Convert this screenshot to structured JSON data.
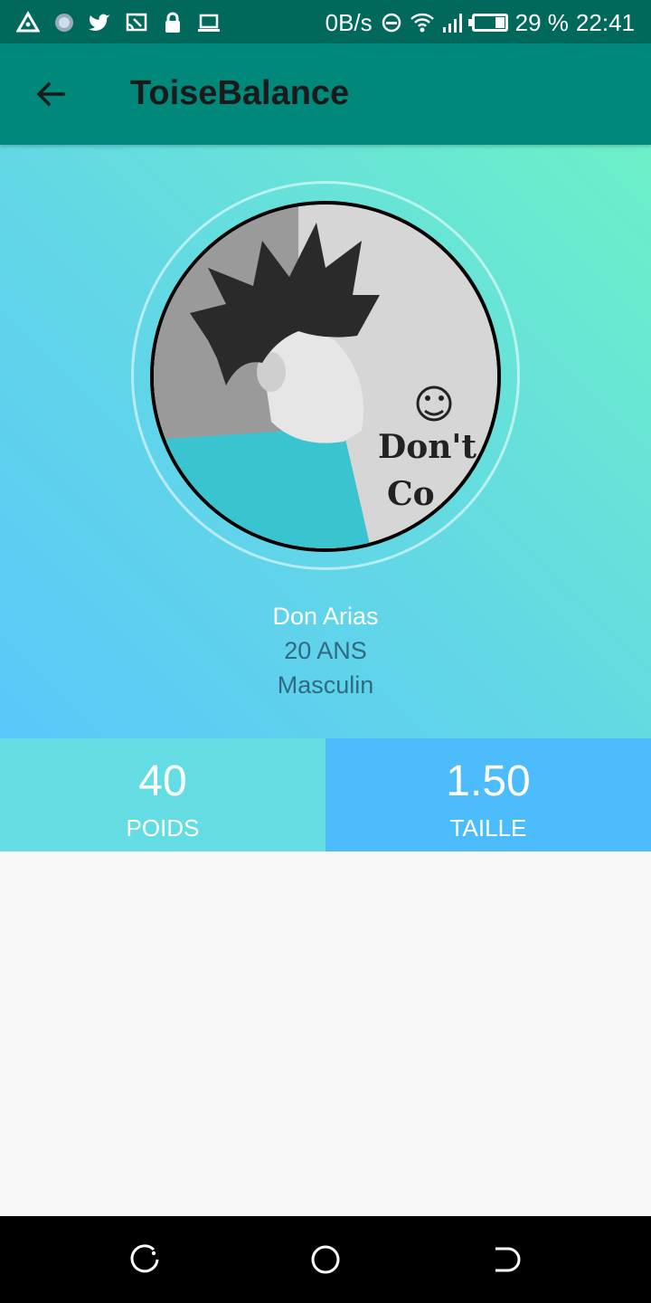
{
  "status_bar": {
    "left_icons": [
      "triangle-icon",
      "dot-icon",
      "twitter-icon",
      "cast-icon",
      "lock-icon",
      "laptop-icon"
    ],
    "net_speed": "0B/s",
    "battery_percent": "29 %",
    "battery_level": 0.29,
    "time": "22:41"
  },
  "app_bar": {
    "title": "ToiseBalance",
    "back_icon": "arrow-back-icon"
  },
  "profile": {
    "name": "Don Arias",
    "age": "20 ANS",
    "gender": "Masculin",
    "photo_text_line1": "Don't",
    "photo_text_line2": "Co"
  },
  "stats": {
    "weight": {
      "value": "40",
      "label": "POIDS"
    },
    "height": {
      "value": "1.50",
      "label": "TAILLE"
    }
  },
  "nav_bar": {
    "recent_icon": "recent-apps-icon",
    "home_icon": "home-icon",
    "back_icon": "nav-back-icon"
  },
  "colors": {
    "status_bar": "#00695c",
    "app_bar": "#00897b",
    "gradient_start": "#5ac8fa",
    "gradient_end": "#6cf0c8",
    "weight_bg": "#64dce4",
    "height_bg": "#4cbcfc"
  }
}
